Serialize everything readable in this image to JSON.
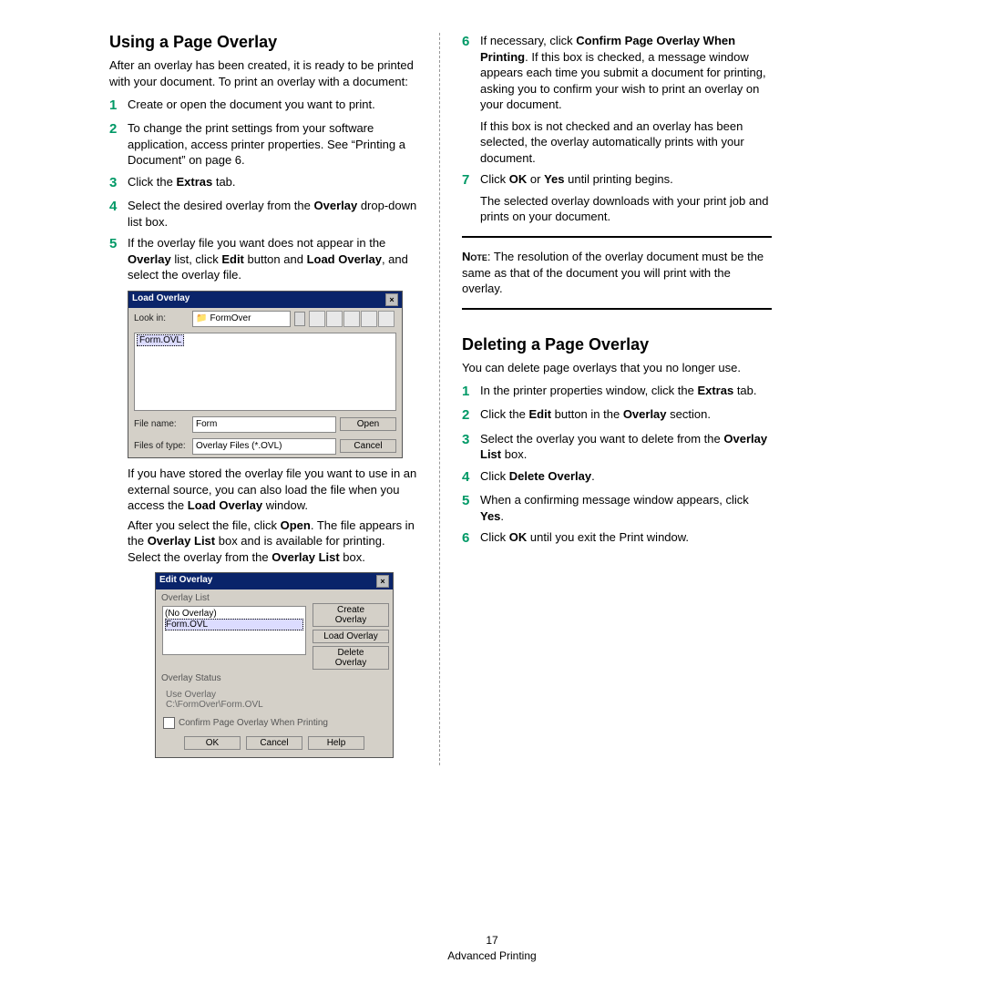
{
  "footer": {
    "page": "17",
    "title": "Advanced Printing"
  },
  "left": {
    "heading": "Using a Page Overlay",
    "intro": "After an overlay has been created, it is ready to be printed with your document. To print an overlay with a document:",
    "step1": "Create or open the document you want to print.",
    "step2": "To change the print settings from your software application, access printer properties. See “Printing a Document” on page 6.",
    "step3a": "Click the ",
    "step3b": "Extras",
    "step3c": " tab.",
    "step4a": "Select the desired overlay from the ",
    "step4b": "Overlay",
    "step4c": " drop-down list box.",
    "step5a": "If the overlay file you want does not appear in the ",
    "step5b": "Overlay",
    "step5c": " list, click ",
    "step5d": "Edit",
    "step5e": " button and ",
    "step5f": "Load Overlay",
    "step5g": ", and select the overlay file.",
    "ss1": {
      "title": "Load Overlay",
      "lookin_label": "Look in:",
      "lookin_value": "FormOver",
      "file_item": "Form.OVL",
      "filename_label": "File name:",
      "filename_value": "Form",
      "filetype_label": "Files of type:",
      "filetype_value": "Overlay Files (*.OVL)",
      "open": "Open",
      "cancel": "Cancel"
    },
    "para1a": "If you have stored the overlay file you want to use in an external source, you can also load the file when you access the ",
    "para1b": "Load Overlay",
    "para1c": " window.",
    "para2a": "After you select the file, click ",
    "para2b": "Open",
    "para2c": ". The file appears in the ",
    "para2d": "Overlay List",
    "para2e": " box and is available for printing. Select the overlay from the ",
    "para2f": "Overlay List",
    "para2g": " box.",
    "ss2": {
      "title": "Edit Overlay",
      "list_label": "Overlay List",
      "item_no": "(No Overlay)",
      "item_form": "Form.OVL",
      "btn_create": "Create Overlay",
      "btn_load": "Load Overlay",
      "btn_delete": "Delete Overlay",
      "status_label": "Overlay Status",
      "status_line1": "Use Overlay",
      "status_line2": "C:\\FormOver\\Form.OVL",
      "cb_label": "Confirm Page Overlay When Printing",
      "ok": "OK",
      "cancel": "Cancel",
      "help": "Help"
    }
  },
  "right": {
    "step6a": "If necessary, click ",
    "step6b": "Confirm Page Overlay When Printing",
    "step6c": ". If this box is checked, a message window appears each time you submit a document for printing, asking you to confirm your wish to print an overlay on your document.",
    "step6d": "If this box is not checked and an overlay has been selected, the overlay automatically prints with your document.",
    "step7a": "Click ",
    "step7b": "OK",
    "step7c": " or ",
    "step7d": "Yes",
    "step7e": " until printing begins.",
    "step7f": "The selected overlay downloads with your print job and prints on your document.",
    "note_label": "Note",
    "note": ": The resolution of the overlay document must be the same as that of the document you will print with the overlay.",
    "heading2": "Deleting a Page Overlay",
    "intro2": "You can delete page overlays that you no longer use.",
    "d1a": "In the printer properties window, click the ",
    "d1b": "Extras",
    "d1c": " tab.",
    "d2a": "Click the ",
    "d2b": "Edit",
    "d2c": " button in the ",
    "d2d": "Overlay",
    "d2e": " section.",
    "d3a": "Select the overlay you want to delete from the ",
    "d3b": "Overlay List",
    "d3c": " box.",
    "d4a": "Click ",
    "d4b": "Delete Overlay",
    "d4c": ".",
    "d5a": "When a confirming message window appears, click ",
    "d5b": "Yes",
    "d5c": ".",
    "d6a": "Click ",
    "d6b": "OK",
    "d6c": " until you exit the Print window."
  }
}
